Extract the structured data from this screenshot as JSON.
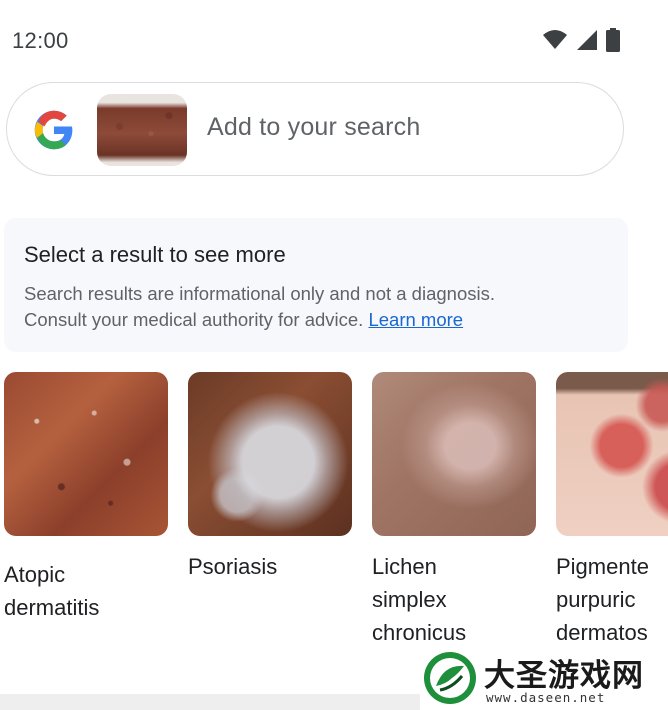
{
  "status_bar": {
    "time": "12:00",
    "icons": [
      "wifi-icon",
      "cellular-signal-icon",
      "battery-icon"
    ]
  },
  "search": {
    "placeholder": "Add to your search",
    "logo": "google-g-logo",
    "thumbnail": "skin-condition-query-image"
  },
  "info_box": {
    "title": "Select a result to see more",
    "line1": "Search results are informational only and not a diagnosis.",
    "line2_text": "Consult your medical authority for advice. ",
    "learn_more": "Learn more"
  },
  "results": [
    {
      "label_lines": [
        "Atopic",
        "dermatitis"
      ]
    },
    {
      "label_lines": [
        "Psoriasis"
      ]
    },
    {
      "label_lines": [
        "Lichen",
        "simplex",
        "chronicus"
      ]
    },
    {
      "label_lines": [
        "Pigmente",
        "purpuric",
        "dermatos"
      ]
    }
  ],
  "watermark": {
    "brand": "大圣游戏网",
    "url": "www.daseen.net"
  },
  "colors": {
    "link": "#1967d2",
    "secondary_text": "#5f6368",
    "info_background": "#f6f8fb",
    "border": "#dadce0"
  }
}
